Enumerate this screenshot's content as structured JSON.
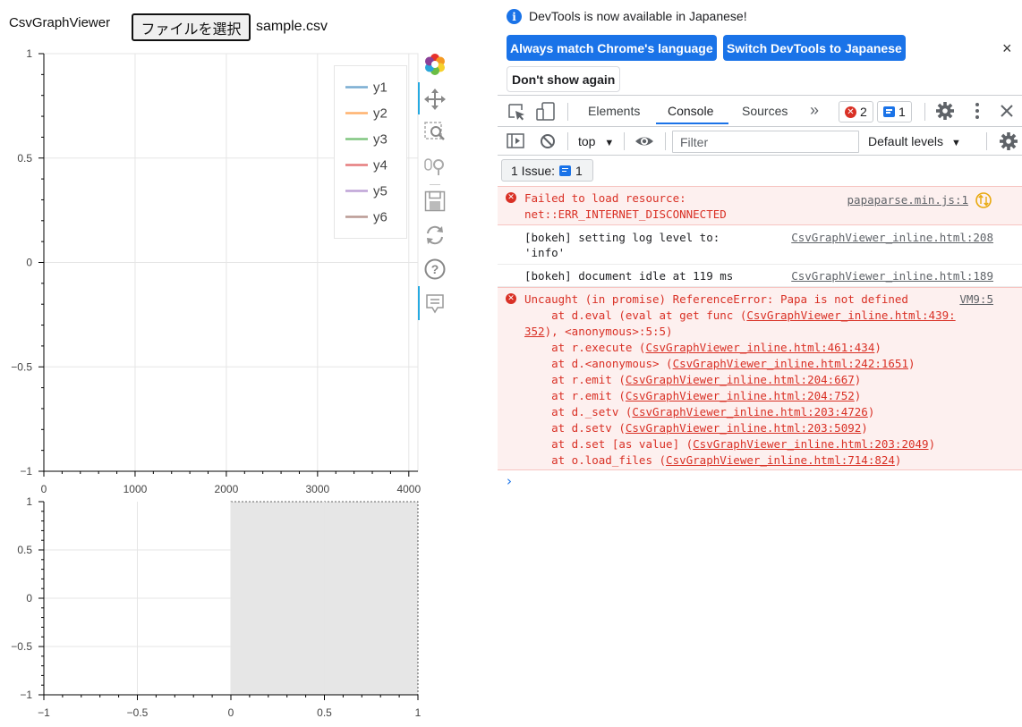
{
  "app": {
    "title": "CsvGraphViewer",
    "file_button_label": "ファイルを選択",
    "file_name": "sample.csv"
  },
  "main_plot": {
    "x_ticks": [
      "0",
      "1000",
      "2000",
      "3000",
      "4000"
    ],
    "y_ticks": [
      "1",
      "0.5",
      "0",
      "−0.5",
      "−1"
    ],
    "legend": [
      {
        "label": "y1",
        "color": "#1f77b4"
      },
      {
        "label": "y2",
        "color": "#ff7f0e"
      },
      {
        "label": "y3",
        "color": "#2ca02c"
      },
      {
        "label": "y4",
        "color": "#d62728"
      },
      {
        "label": "y5",
        "color": "#9467bd"
      },
      {
        "label": "y6",
        "color": "#8c564b"
      }
    ]
  },
  "range_plot": {
    "x_ticks": [
      "−1",
      "−0.5",
      "0",
      "0.5",
      "1"
    ],
    "y_ticks": [
      "1",
      "0.5",
      "0",
      "−0.5",
      "−1"
    ],
    "selection": {
      "x_start": 0,
      "x_end": 1
    }
  },
  "toolbar": {
    "tools": [
      "bokeh-logo-icon",
      "pan-icon",
      "box-zoom-icon",
      "wheel-zoom-icon",
      "save-icon",
      "reset-icon",
      "help-icon",
      "hover-icon"
    ]
  },
  "devtools": {
    "infobar": {
      "message": "DevTools is now available in Japanese!",
      "match_button": "Always match Chrome's language",
      "switch_button": "Switch DevTools to Japanese",
      "dismiss_button": "Don't show again",
      "close": "×"
    },
    "tabs": [
      "Elements",
      "Console",
      "Sources"
    ],
    "more_tabs": "»",
    "error_count": "2",
    "message_count": "1",
    "console_toolbar": {
      "context": "top",
      "filter_placeholder": "Filter",
      "levels": "Default levels"
    },
    "issues": {
      "label": "1 Issue:",
      "count": "1"
    },
    "messages": [
      {
        "type": "error",
        "line1": "Failed to load resource:",
        "line2": "net::ERR_INTERNET_DISCONNECTED",
        "source": "papaparse.min.js:1"
      },
      {
        "type": "info",
        "line1": "[bokeh] setting log level to:",
        "line2": "'info'",
        "source": "CsvGraphViewer_inline.html:208"
      },
      {
        "type": "info",
        "line1": "[bokeh] document idle at 119 ms",
        "source": "CsvGraphViewer_inline.html:189"
      },
      {
        "type": "error",
        "line1": "Uncaught (in promise) ReferenceError: Papa is not defined",
        "source": "VM9:5",
        "stack": [
          {
            "pre": "    at d.eval (eval at get func (",
            "link": "CsvGraphViewer_inline.html:439:",
            "post": ""
          },
          {
            "pre": "",
            "link": "352",
            "post": "), <anonymous>:5:5)"
          },
          {
            "pre": "    at r.execute (",
            "link": "CsvGraphViewer_inline.html:461:434",
            "post": ")"
          },
          {
            "pre": "    at d.<anonymous> (",
            "link": "CsvGraphViewer_inline.html:242:1651",
            "post": ")"
          },
          {
            "pre": "    at r.emit (",
            "link": "CsvGraphViewer_inline.html:204:667",
            "post": ")"
          },
          {
            "pre": "    at r.emit (",
            "link": "CsvGraphViewer_inline.html:204:752",
            "post": ")"
          },
          {
            "pre": "    at d._setv (",
            "link": "CsvGraphViewer_inline.html:203:4726",
            "post": ")"
          },
          {
            "pre": "    at d.setv (",
            "link": "CsvGraphViewer_inline.html:203:5092",
            "post": ")"
          },
          {
            "pre": "    at d.set [as value] (",
            "link": "CsvGraphViewer_inline.html:203:2049",
            "post": ")"
          },
          {
            "pre": "    at o.load_files (",
            "link": "CsvGraphViewer_inline.html:714:824",
            "post": ")"
          }
        ]
      }
    ],
    "prompt": "›"
  }
}
